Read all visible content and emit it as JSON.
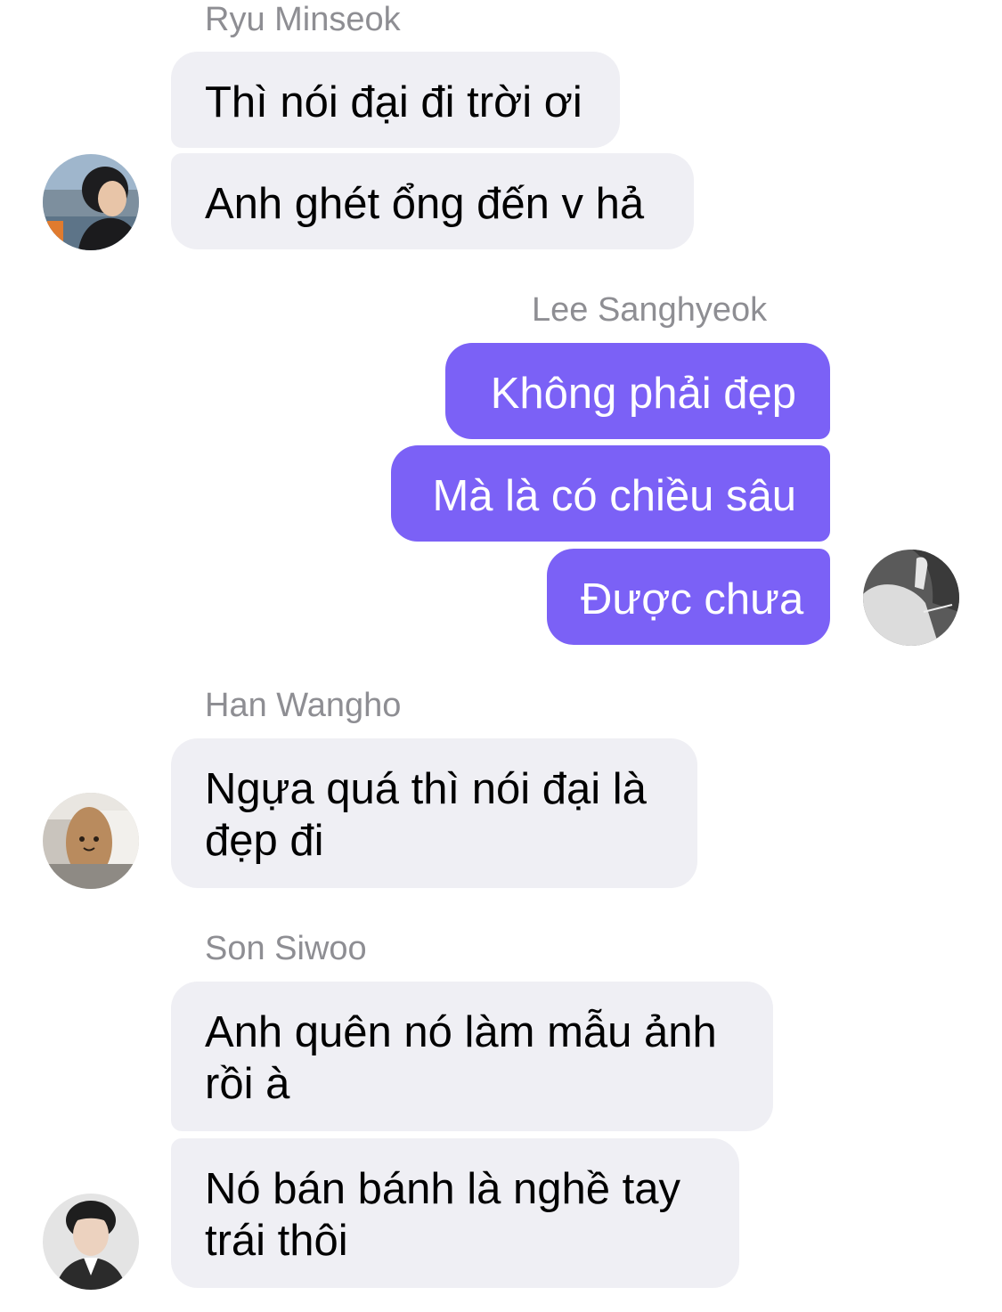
{
  "messages": [
    {
      "sender": "Ryu Minseok",
      "bubbles": [
        "Thì nói đại đi trời ơi",
        "Anh ghét ổng đến v hả"
      ],
      "direction": "incoming"
    },
    {
      "sender": "Lee Sanghyeok",
      "bubbles": [
        "Không phải đẹp",
        "Mà là có chiều sâu",
        "Được chưa"
      ],
      "direction": "outgoing"
    },
    {
      "sender": "Han Wangho",
      "bubbles": [
        "Ngựa quá thì nói đại là đẹp đi"
      ],
      "direction": "incoming"
    },
    {
      "sender": "Son Siwoo",
      "bubbles": [
        "Anh quên nó làm mẫu ảnh rồi à",
        "Nó bán bánh là nghề tay trái thôi"
      ],
      "direction": "incoming"
    }
  ],
  "colors": {
    "incoming_bubble": "#efeff4",
    "outgoing_bubble": "#7b61f6",
    "sender_label": "#8e8e93"
  }
}
